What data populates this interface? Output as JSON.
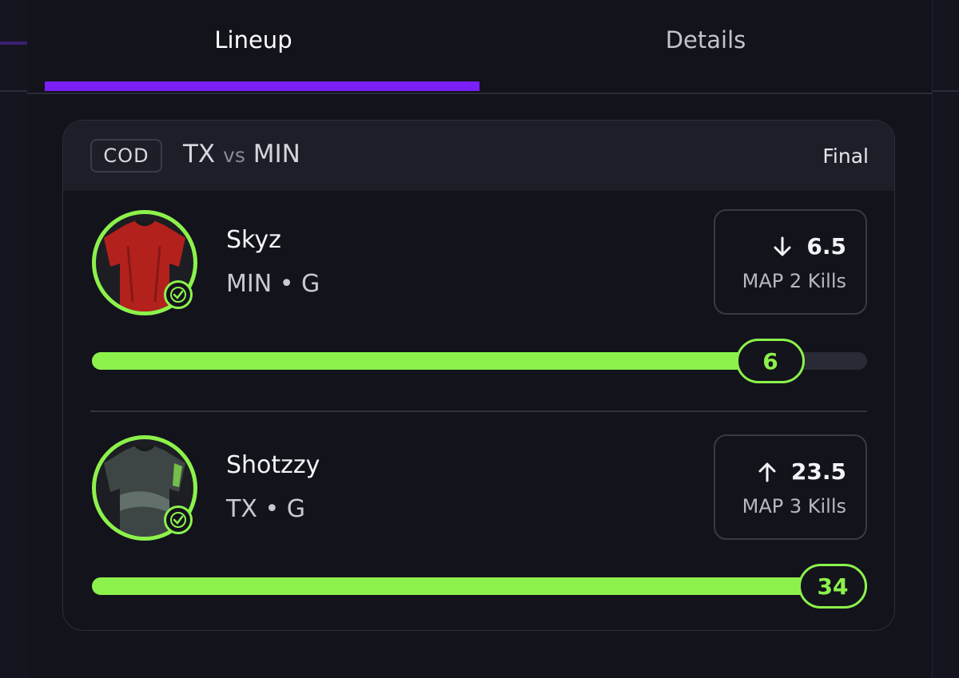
{
  "tabs": [
    {
      "label": "Lineup",
      "active": true
    },
    {
      "label": "Details",
      "active": false
    }
  ],
  "colors": {
    "accent": "#7a1ff5",
    "progress": "#8cf24b",
    "background": "#13131c",
    "header": "#1e1e28"
  },
  "card": {
    "league": "COD",
    "team_a": "TX",
    "vs": "vs",
    "team_b": "MIN",
    "status": "Final"
  },
  "players": [
    {
      "name": "Skyz",
      "team": "MIN",
      "separator": "•",
      "position": "G",
      "direction_icon": "arrow-down-icon",
      "line": "6.5",
      "stat_label": "MAP 2 Kills",
      "result": "6",
      "progress_fraction": 0.92,
      "jersey_color": "#b3211c"
    },
    {
      "name": "Shotzzy",
      "team": "TX",
      "separator": "•",
      "position": "G",
      "direction_icon": "arrow-up-icon",
      "line": "23.5",
      "stat_label": "MAP 3 Kills",
      "result": "34",
      "progress_fraction": 1.0,
      "jersey_color": "#3d4644"
    }
  ]
}
